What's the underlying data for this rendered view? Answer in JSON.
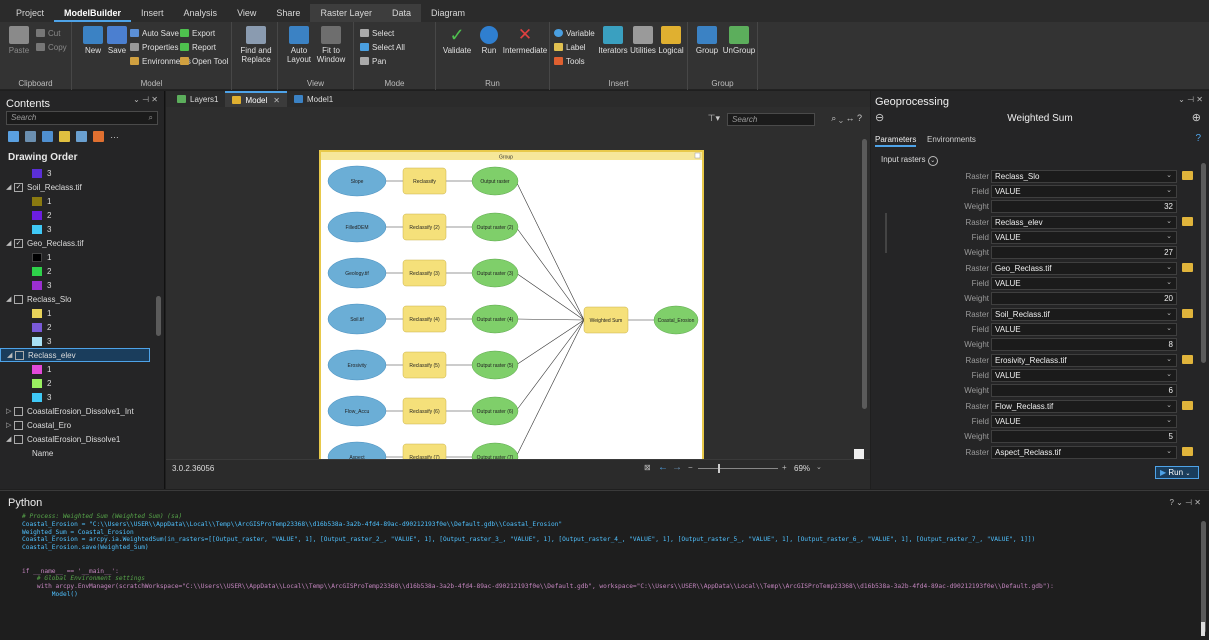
{
  "tabs": [
    "Project",
    "ModelBuilder",
    "Insert",
    "Analysis",
    "View",
    "Share",
    "Raster Layer",
    "Data",
    "Diagram"
  ],
  "ribbon": {
    "clipboard": {
      "label": "Clipboard",
      "paste": "Paste",
      "cut": "Cut",
      "copy": "Copy"
    },
    "model": {
      "label": "Model",
      "new": "New",
      "save": "Save",
      "auto_save": "Auto Save",
      "properties": "Properties",
      "environments": "Environments",
      "export": "Export",
      "report": "Report",
      "open_tool": "Open Tool",
      "find_replace": "Find and Replace"
    },
    "view": {
      "label": "View",
      "auto_layout": "Auto Layout",
      "fit_window": "Fit to Window"
    },
    "mode": {
      "label": "Mode",
      "select": "Select",
      "select_all": "Select All",
      "pan": "Pan"
    },
    "run": {
      "label": "Run",
      "validate": "Validate",
      "run": "Run",
      "intermediate": "Intermediate"
    },
    "insert": {
      "label": "Insert",
      "variable": "Variable",
      "label_btn": "Label",
      "tools": "Tools",
      "iterators": "Iterators",
      "utilities": "Utilities",
      "logical": "Logical"
    },
    "group": {
      "label": "Group",
      "group": "Group",
      "ungroup": "UnGroup"
    }
  },
  "contents": {
    "title": "Contents",
    "search_placeholder": "Search",
    "drawing_order": "Drawing Order",
    "layers": [
      {
        "name": "",
        "legend": [
          {
            "label": "3",
            "color": "#5a2fd6"
          }
        ]
      },
      {
        "name": "Soil_Reclass.tif",
        "checked": true,
        "legend": [
          {
            "label": "1",
            "color": "#8a7a10"
          },
          {
            "label": "2",
            "color": "#6c1ee0"
          },
          {
            "label": "3",
            "color": "#3fc8f5"
          }
        ]
      },
      {
        "name": "Geo_Reclass.tif",
        "checked": true,
        "legend": [
          {
            "label": "1",
            "color": "#000000"
          },
          {
            "label": "2",
            "color": "#2ed24a"
          },
          {
            "label": "3",
            "color": "#9b2fd0"
          }
        ]
      },
      {
        "name": "Reclass_Slo",
        "checked": false,
        "legend": [
          {
            "label": "1",
            "color": "#e8d35a"
          },
          {
            "label": "2",
            "color": "#7a5ad8"
          },
          {
            "label": "3",
            "color": "#a8e0f5"
          }
        ]
      },
      {
        "name": "Reclass_elev",
        "checked": false,
        "selected": true,
        "legend": [
          {
            "label": "1",
            "color": "#e24ad8"
          },
          {
            "label": "2",
            "color": "#9af060"
          },
          {
            "label": "3",
            "color": "#3fc8f5"
          }
        ]
      }
    ],
    "collapsed": [
      "CoastalErosion_Dissolve1_Int",
      "Coastal_Ero",
      "CoastalErosion_Dissolve1"
    ],
    "footer_label": "Name"
  },
  "doc_tabs": [
    "Layers1",
    "Model",
    "Model1"
  ],
  "model": {
    "search_placeholder": "Search",
    "group_label": "Group",
    "inputs": [
      "Slope",
      "FilledDEM",
      "Geology.tif",
      "Soil.tif",
      "Erosivity",
      "Flow_Accu",
      "Aspect"
    ],
    "tools": [
      "Reclassify",
      "Reclassify (2)",
      "Reclassify (3)",
      "Reclassify (4)",
      "Reclassify (5)",
      "Reclassify (6)",
      "Reclassify (7)"
    ],
    "outputs": [
      "Output raster",
      "Output raster (2)",
      "Output raster (3)",
      "Output raster (4)",
      "Output raster (5)",
      "Output raster (6)",
      "Output raster (7)"
    ],
    "weighted_sum": "Weighted Sum",
    "final_output": "Coastal_Erosion",
    "version": "3.0.2.36056",
    "zoom": "69%",
    "colors": {
      "input": "#6baed6",
      "tool": "#f5e07a",
      "output": "#7fcf6a",
      "group_border": "#e8c94a"
    }
  },
  "geo": {
    "title": "Geoprocessing",
    "tool_name": "Weighted Sum",
    "tab_params": "Parameters",
    "tab_env": "Environments",
    "input_rasters": "Input rasters",
    "label_raster": "Raster",
    "label_field": "Field",
    "label_weight": "Weight",
    "rows": [
      {
        "raster": "Reclass_Slo",
        "field": "VALUE",
        "weight": "32"
      },
      {
        "raster": "Reclass_elev",
        "field": "VALUE",
        "weight": "27"
      },
      {
        "raster": "Geo_Reclass.tif",
        "field": "VALUE",
        "weight": "20"
      },
      {
        "raster": "Soil_Reclass.tif",
        "field": "VALUE",
        "weight": "8"
      },
      {
        "raster": "Erosivity_Reclass.tif",
        "field": "VALUE",
        "weight": "6"
      },
      {
        "raster": "Flow_Reclass.tif",
        "field": "VALUE",
        "weight": "5"
      },
      {
        "raster": "Aspect_Reclass.tif"
      }
    ],
    "run_label": "Run"
  },
  "python": {
    "title": "Python",
    "lines": [
      {
        "cls": "c-cm",
        "text": "# Process: Weighted Sum (Weighted Sum) (sa)"
      },
      {
        "cls": "c-txt",
        "text": "Coastal_Erosion = \"C:\\\\Users\\\\USER\\\\AppData\\\\Local\\\\Temp\\\\ArcGISProTemp23368\\\\d16b538a-3a2b-4fd4-89ac-d90212193f0e\\\\Default.gdb\\\\Coastal_Erosion\""
      },
      {
        "cls": "c-txt",
        "text": "Weighted_Sum = Coastal_Erosion"
      },
      {
        "cls": "c-txt",
        "text": "Coastal_Erosion = arcpy.ia.WeightedSum(in_rasters=[[Output_raster, \"VALUE\", 1], [Output_raster_2_, \"VALUE\", 1], [Output_raster_3_, \"VALUE\", 1], [Output_raster_4_, \"VALUE\", 1], [Output_raster_5_, \"VALUE\", 1], [Output_raster_6_, \"VALUE\", 1], [Output_raster_7_, \"VALUE\", 1]])"
      },
      {
        "cls": "c-txt",
        "text": "Coastal_Erosion.save(Weighted_Sum)"
      },
      {
        "cls": "",
        "text": ""
      },
      {
        "cls": "",
        "text": ""
      },
      {
        "cls": "c-kw",
        "text": "if __name__ == '__main__':"
      },
      {
        "cls": "c-cm",
        "text": "    # Global Environment settings"
      },
      {
        "cls": "c-kw",
        "text": "    with arcpy.EnvManager(scratchWorkspace=\"C:\\\\Users\\\\USER\\\\AppData\\\\Local\\\\Temp\\\\ArcGISProTemp23368\\\\d16b538a-3a2b-4fd4-89ac-d90212193f0e\\\\Default.gdb\", workspace=\"C:\\\\Users\\\\USER\\\\AppData\\\\Local\\\\Temp\\\\ArcGISProTemp23368\\\\d16b538a-3a2b-4fd4-89ac-d90212193f0e\\\\Default.gdb\"):"
      },
      {
        "cls": "c-txt",
        "text": "        Model()"
      }
    ]
  }
}
